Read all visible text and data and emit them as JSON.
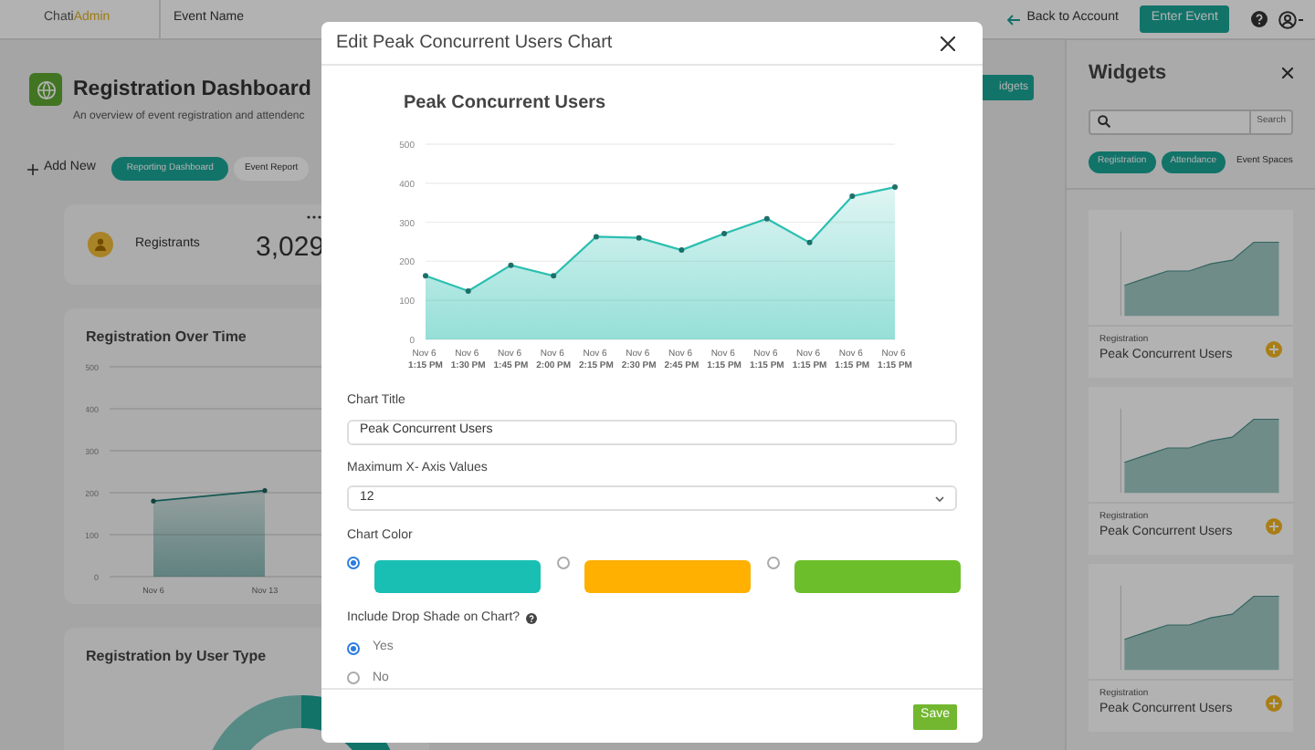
{
  "top_bar": {
    "logo": {
      "first": "Chati",
      "second": "Admin"
    },
    "event_name": "Event Name",
    "back_link": "Back to Account",
    "enter_button": "Enter Event"
  },
  "dashboard": {
    "title": "Registration Dashboard",
    "subtitle": "An overview of event registration and attendenc",
    "widgets_button": "idgets",
    "add_new": "Add New",
    "tabs": [
      {
        "label": "Reporting Dashboard",
        "selected": true
      },
      {
        "label": "Event Report",
        "selected": false
      }
    ],
    "stat_card": {
      "label": "Registrants",
      "value": "3,029"
    },
    "time_card": {
      "title": "Registration Over Time",
      "chart_data": {
        "type": "area",
        "categories": [
          "Nov 6",
          "Nov 13"
        ],
        "values": [
          180,
          205
        ],
        "grid": true,
        "ylim": [
          0,
          500
        ],
        "yticks": [
          0,
          100,
          200,
          300,
          400,
          500
        ]
      }
    },
    "type_card": {
      "title": "Registration by User Type"
    }
  },
  "widgets_panel": {
    "title": "Widgets",
    "search_button": "Search",
    "chips": [
      {
        "label": "Registration",
        "selected": true
      },
      {
        "label": "Attendance",
        "selected": true
      },
      {
        "label": "Event Spaces",
        "selected": false
      }
    ],
    "items": [
      {
        "category": "Registration",
        "name": "Peak Concurrent Users"
      },
      {
        "category": "Registration",
        "name": "Peak Concurrent Users"
      },
      {
        "category": "Registration",
        "name": "Peak Concurrent Users"
      }
    ]
  },
  "modal": {
    "title": "Edit Peak Concurrent Users Chart",
    "chart_data": {
      "type": "area",
      "title": "Peak Concurrent Users",
      "categories": [
        "Nov 6 1:15 PM",
        "Nov 6 1:30 PM",
        "Nov 6 1:45 PM",
        "Nov 6 2:00 PM",
        "Nov 6 2:15 PM",
        "Nov 6 2:30 PM",
        "Nov 6 2:45 PM",
        "Nov 6 1:15 PM",
        "Nov 6 1:15 PM",
        "Nov 6 1:15 PM",
        "Nov 6 1:15 PM",
        "Nov 6 1:15 PM"
      ],
      "values": [
        163,
        124,
        190,
        163,
        263,
        260,
        229,
        271,
        309,
        248,
        367,
        390
      ],
      "grid": true,
      "ylim": [
        0,
        500
      ],
      "yticks": [
        0,
        100,
        200,
        300,
        400,
        500
      ]
    },
    "fields": [
      {
        "kind": "text",
        "label": "Chart Title",
        "value": "Peak Concurrent Users"
      },
      {
        "kind": "select",
        "label": "Maximum X- Axis Values",
        "value": "12"
      }
    ],
    "color_label": "Chart Color",
    "colors": [
      {
        "color": "#1abfb4",
        "selected": true
      },
      {
        "color": "#ffb000",
        "selected": false
      },
      {
        "color": "#6cbf2a",
        "selected": false
      }
    ],
    "shade_label": "Include Drop Shade on Chart?",
    "shade_options": [
      {
        "label": "Yes",
        "selected": true
      },
      {
        "label": "No",
        "selected": false
      }
    ],
    "save_button": "Save"
  }
}
